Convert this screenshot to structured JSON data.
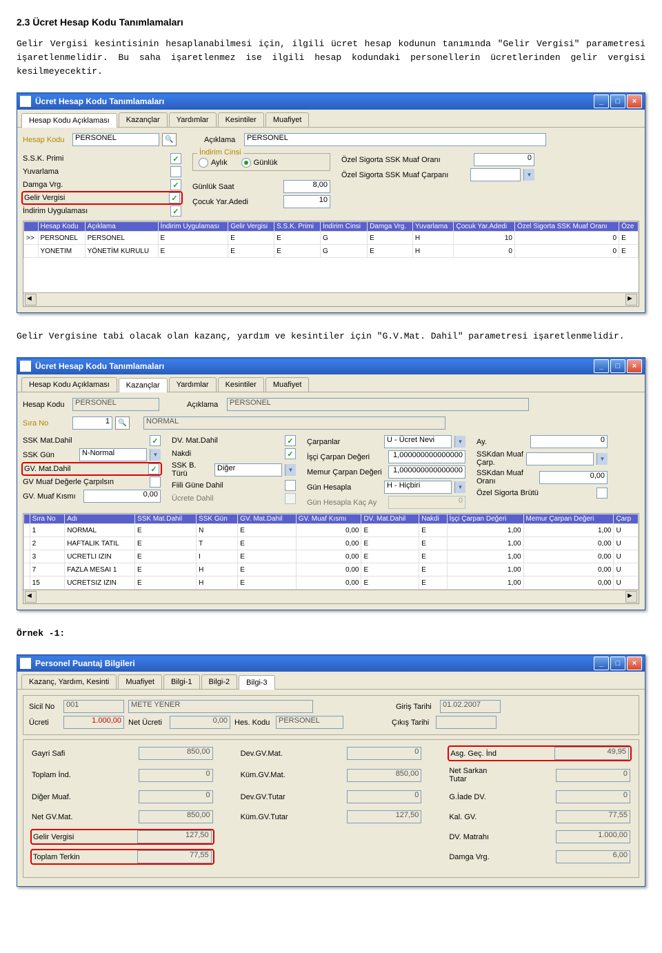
{
  "doc": {
    "section_title": "2.3 Ücret Hesap Kodu Tanımlamaları",
    "para1": "Gelir Vergisi kesintisinin hesaplanabilmesi için, ilgili ücret hesap kodunun tanımında \"Gelir Vergisi\" parametresi işaretlenmelidir. Bu saha işaretlenmez ise ilgili hesap kodundaki personellerin ücretlerinden gelir vergisi kesilmeyecektir.",
    "para2": "Gelir Vergisine tabi olacak olan kazanç, yardım ve kesintiler için \"G.V.Mat. Dahil\" parametresi işaretlenmelidir.",
    "example_label": "Örnek -1:"
  },
  "win1": {
    "title": "Ücret Hesap Kodu Tanımlamaları",
    "tabs": [
      "Hesap Kodu Açıklaması",
      "Kazançlar",
      "Yardımlar",
      "Kesintiler",
      "Muafiyet"
    ],
    "hesap_kodu_lbl": "Hesap Kodu",
    "hesap_kodu_val": "PERSONEL",
    "aciklama_lbl": "Açıklama",
    "aciklama_val": "PERSONEL",
    "ssk_primi": "S.S.K. Primi",
    "yuvarlama": "Yuvarlama",
    "damga": "Damga Vrg.",
    "gelir_vergisi": "Gelir Vergisi",
    "indirim_uyg": "İndirim Uygulaması",
    "indirim_cinsi": "İndirim Cinsi",
    "aylik": "Aylık",
    "gunluk": "Günlük",
    "gunluk_saat": "Günlük Saat",
    "gunluk_saat_v": "8,00",
    "cocuk": "Çocuk Yar.Adedi",
    "cocuk_v": "10",
    "ozs_oran": "Özel Sigorta SSK Muaf Oranı",
    "ozs_oran_v": "0",
    "ozs_carpan": "Özel Sigorta SSK Muaf Çarpanı",
    "grid_h": [
      "",
      "Hesap Kodu",
      "Açıklama",
      "İndirim Uygulaması",
      "Gelir Vergisi",
      "S.S.K. Primi",
      "İndirim Cinsi",
      "Damga Vrg.",
      "Yuvarlama",
      "Çocuk Yar.Adedi",
      "Özel Sigorta SSK Muaf Oranı",
      "Öze"
    ],
    "grid_r": [
      [
        ">>",
        "PERSONEL",
        "PERSONEL",
        "E",
        "E",
        "E",
        "G",
        "E",
        "H",
        "10",
        "0",
        "E"
      ],
      [
        "",
        "YONETIM",
        "YÖNETİM KURULU",
        "E",
        "E",
        "E",
        "G",
        "E",
        "H",
        "0",
        "0",
        "E"
      ]
    ]
  },
  "win2": {
    "title": "Ücret Hesap Kodu Tanımlamaları",
    "tabs": [
      "Hesap Kodu Açıklaması",
      "Kazançlar",
      "Yardımlar",
      "Kesintiler",
      "Muafiyet"
    ],
    "hesap_kodu_lbl": "Hesap Kodu",
    "hesap_kodu_val": "PERSONEL",
    "aciklama_lbl": "Açıklama",
    "aciklama_val": "PERSONEL",
    "sira_no_lbl": "Sıra No",
    "sira_no_val": "1",
    "sira_no_name": "NORMAL",
    "left": [
      {
        "l": "SSK Mat.Dahil",
        "v": "chk"
      },
      {
        "l": "SSK Gün",
        "v": "N-Normal",
        "type": "sel"
      },
      {
        "l": "GV. Mat.Dahil",
        "v": "chk",
        "hl": true
      },
      {
        "l": "GV Muaf Değerle Çarpılsın",
        "v": ""
      },
      {
        "l": "GV. Muaf Kısmı",
        "v": "0,00",
        "type": "num"
      }
    ],
    "mid": [
      {
        "l": "DV. Mat.Dahil",
        "v": "chk"
      },
      {
        "l": "Nakdi",
        "v": "chk"
      },
      {
        "l": "SSK B. Türü",
        "v": "Diğer",
        "type": "sel"
      },
      {
        "l": "Fiili Güne Dahil",
        "v": ""
      },
      {
        "l": "Ücrete Dahil",
        "v": "",
        "dis": true
      }
    ],
    "mid2": [
      {
        "l": "Çarpanlar",
        "v": "U - Ücret Nevi",
        "type": "sel"
      },
      {
        "l": "İşçi Çarpan Değeri",
        "v": "1,000000000000000"
      },
      {
        "l": "Memur Çarpan Değeri",
        "v": "1,000000000000000"
      },
      {
        "l": "Gün Hesapla",
        "v": "H - Hiçbiri",
        "type": "sel"
      },
      {
        "l": "Gün Hesapla Kaç Ay",
        "v": "0",
        "dis": true
      }
    ],
    "right": [
      {
        "l": "Ay.",
        "v": "0"
      },
      {
        "l": "SSKdan Muaf Çarp.",
        "type": "sel"
      },
      {
        "l": "SSKdan Muaf Oranı",
        "v": "0,00"
      },
      {
        "l": "Özel Sigorta Brütü",
        "v": ""
      }
    ],
    "grid_h": [
      "",
      "Sıra No",
      "Adı",
      "SSK Mat.Dahil",
      "SSK Gün",
      "GV. Mat.Dahil",
      "GV. Muaf Kısmı",
      "DV. Mat.Dahil",
      "Nakdi",
      "İşçi Çarpan Değeri",
      "Memur Çarpan Değeri",
      "Çarp"
    ],
    "grid_r": [
      [
        "",
        "1",
        "NORMAL",
        "E",
        "N",
        "E",
        "0,00",
        "E",
        "E",
        "1,00",
        "1,00",
        "U"
      ],
      [
        "",
        "2",
        "HAFTALIK TATIL",
        "E",
        "T",
        "E",
        "0,00",
        "E",
        "E",
        "1,00",
        "0,00",
        "U"
      ],
      [
        "",
        "3",
        "UCRETLI IZIN",
        "E",
        "I",
        "E",
        "0,00",
        "E",
        "E",
        "1,00",
        "0,00",
        "U"
      ],
      [
        "",
        "7",
        "FAZLA MESAI 1",
        "E",
        "H",
        "E",
        "0,00",
        "E",
        "E",
        "1,00",
        "0,00",
        "U"
      ],
      [
        "",
        "15",
        "UCRETSIZ IZIN",
        "E",
        "H",
        "E",
        "0,00",
        "E",
        "E",
        "1,00",
        "0,00",
        "U"
      ]
    ]
  },
  "win3": {
    "title": "Personel Puantaj Bilgileri",
    "tabs": [
      "Kazanç, Yardım, Kesinti",
      "Muafiyet",
      "Bilgi-1",
      "Bilgi-2",
      "Bilgi-3"
    ],
    "top": {
      "sicil_l": "Sicil No",
      "sicil_v": "001",
      "name_v": "METE YENER",
      "giris_l": "Giriş Tarihi",
      "giris_v": "01.02.2007",
      "ucret_l": "Ücreti",
      "ucret_v": "1.000,00",
      "net_l": "Net Ücreti",
      "net_v": "0,00",
      "hes_l": "Hes. Kodu",
      "hes_v": "PERSONEL",
      "cikis_l": "Çıkış Tarihi"
    },
    "rows": [
      [
        {
          "l": "Gayri Safi",
          "v": "850,00"
        },
        {
          "l": "Dev.GV.Mat.",
          "v": "0"
        },
        {
          "l": "Asg. Geç. İnd",
          "v": "49,95",
          "hl": true
        }
      ],
      [
        {
          "l": "Toplam İnd.",
          "v": "0"
        },
        {
          "l": "Küm.GV.Mat.",
          "v": "850,00"
        },
        {
          "l": "Net Sarkan Tutar",
          "v": "0"
        }
      ],
      [
        {
          "l": "Diğer Muaf.",
          "v": "0"
        },
        {
          "l": "Dev.GV.Tutar",
          "v": "0"
        },
        {
          "l": "G.İade DV.",
          "v": "0"
        }
      ],
      [
        {
          "l": "Net GV.Mat.",
          "v": "850,00"
        },
        {
          "l": "Küm.GV.Tutar",
          "v": "127,50"
        },
        {
          "l": "Kal. GV.",
          "v": "77,55"
        }
      ],
      [
        {
          "l": "Gelir Vergisi",
          "v": "127,50",
          "hl": true
        },
        {
          "l": "",
          "v": ""
        },
        {
          "l": "DV. Matrahı",
          "v": "1.000,00"
        }
      ],
      [
        {
          "l": "Toplam Terkin",
          "v": "77,55",
          "hl": true
        },
        {
          "l": "",
          "v": ""
        },
        {
          "l": "Damga Vrg.",
          "v": "6,00"
        }
      ]
    ]
  }
}
